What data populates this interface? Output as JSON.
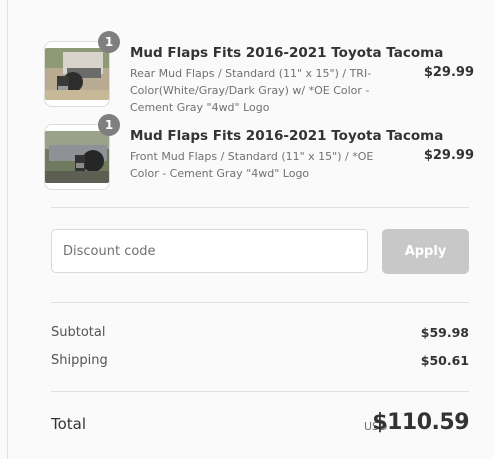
{
  "cart": {
    "items": [
      {
        "quantity": "1",
        "title": "Mud Flaps Fits 2016-2021 Toyota Tacoma",
        "description": "Rear Mud Flaps / Standard (11\" x 15\") / TRI-Color(White/Gray/Dark Gray) w/ *OE Color - Cement Gray \"4wd\" Logo",
        "price": "$29.99"
      },
      {
        "quantity": "1",
        "title": "Mud Flaps Fits 2016-2021 Toyota Tacoma",
        "description": "Front Mud Flaps / Standard (11\" x 15\") / *OE Color - Cement Gray \"4wd\" Logo",
        "price": "$29.99"
      }
    ]
  },
  "discount": {
    "placeholder": "Discount code",
    "apply_label": "Apply"
  },
  "summary": {
    "subtotal_label": "Subtotal",
    "subtotal_value": "$59.98",
    "shipping_label": "Shipping",
    "shipping_value": "$50.61",
    "total_label": "Total",
    "currency": "USD",
    "total_value": "$110.59"
  },
  "colors": {
    "badge": "#7f7f7f",
    "apply_disabled": "#c8c8c8",
    "divider": "#e1e1e1"
  }
}
